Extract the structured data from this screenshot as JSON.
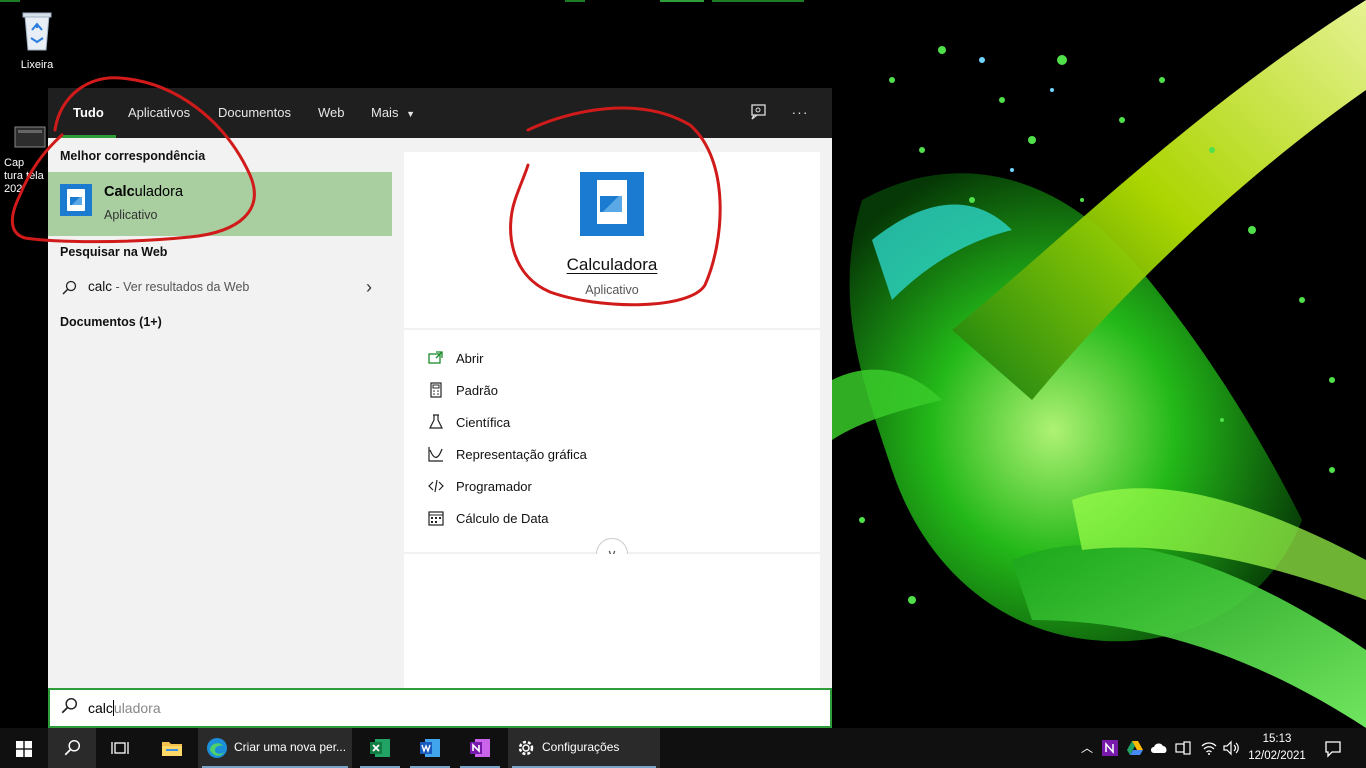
{
  "desktop": {
    "icons": [
      {
        "label": "Lixeira"
      },
      {
        "label": "Cap tura tela 202"
      }
    ]
  },
  "search_panel": {
    "tabs": [
      {
        "label": "Tudo",
        "active": true
      },
      {
        "label": "Aplicativos"
      },
      {
        "label": "Documentos"
      },
      {
        "label": "Web"
      },
      {
        "label": "Mais"
      }
    ],
    "header_icons": [
      "feedback-icon",
      "more-options-icon"
    ],
    "more_glyph": "···",
    "best_match": {
      "section_title": "Melhor correspondência",
      "name_highlight": "Calc",
      "name_rest": "uladora",
      "subtitle": "Aplicativo"
    },
    "web_search": {
      "section_title": "Pesquisar na Web",
      "query": "calc",
      "suffix": " - Ver resultados da Web"
    },
    "documents": {
      "section_title": "Documentos (1+)"
    },
    "preview": {
      "name": "Calculadora",
      "subtitle": "Aplicativo",
      "actions": [
        {
          "label": "Abrir",
          "icon": "open-icon"
        },
        {
          "label": "Padrão",
          "icon": "calculator-icon"
        },
        {
          "label": "Científica",
          "icon": "flask-icon"
        },
        {
          "label": "Representação gráfica",
          "icon": "graph-icon"
        },
        {
          "label": "Programador",
          "icon": "code-icon"
        },
        {
          "label": "Cálculo de Data",
          "icon": "calendar-icon"
        }
      ]
    },
    "search_box": {
      "typed": "calc",
      "suggestion": "uladora"
    }
  },
  "taskbar": {
    "edge_window_title": "Criar uma nova per...",
    "settings_title": "Configurações",
    "clock_time": "15:13",
    "clock_date": "12/02/2021"
  },
  "colors": {
    "accent_green": "#2e9e3a",
    "selection_green": "#a9cfa1",
    "annotation_red": "#d11a1a"
  }
}
